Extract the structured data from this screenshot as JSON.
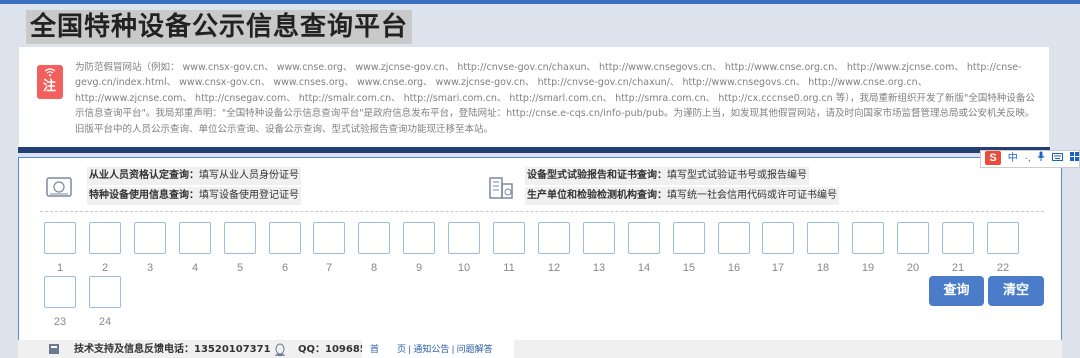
{
  "page": {
    "title": "全国特种设备公示信息查询平台"
  },
  "notice": {
    "icon_label": "注",
    "icon": "wifi-icon",
    "text": "为防范假冒网站（例如： www.cnsx-gov.cn、 www.cnse.org、 www.zjcnse-gov.cn、 http://cnvse-gov.cn/chaxun、 http://www.cnsegovs.cn、 http://www.cnse.org.cn、 http://www.zjcnse.com、 http://cnse-gevg.cn/index.html、 www.cnsx-gov.cn、 www.cnses.org、 www.cnse.org、 www.zjcnse-gov.cn、 http://cnvse-gov.cn/chaxun/、 http://www.cnsegovs.cn、 http://www.cnse.org.cn、 http://www.zjcnse.com、 http://cnsegav.com、 http://smalr.com.cn、 http://smari.com.cn、 http://smarl.com.cn、 http://smra.com.cn、 http://cx.cccnse0.org.cn 等），我局重新组织开发了新版\"全国特种设备公示信息查询平台\"。我局郑重声明：\"全国特种设备公示信息查询平台\"是政府信息发布平台，登陆网址：http://cnse.e-cqs.cn/info-pub/pub。为谨防上当，如发现其他假冒网站，请及时向国家市场监督管理总局或公安机关反映。旧版平台中的人员公示查询、单位公示查询、设备公示查询、型式试验报告查询功能现迁移至本站。"
  },
  "ime": {
    "logo": "S",
    "items": [
      "中",
      "·,",
      "mic-icon",
      "keyboard-icon",
      "grid-icon"
    ]
  },
  "query_left": {
    "icon": "id-card-icon",
    "items": [
      {
        "bold": "从业人员资格认定查询：",
        "hint": "填写从业人员身份证号"
      },
      {
        "bold": "特种设备使用信息查询：",
        "hint": "填写设备使用登记证号"
      }
    ]
  },
  "query_right": {
    "icon": "building-icon",
    "items": [
      {
        "bold": "设备型式试验报告和证书查询：",
        "hint": "填写型式试验证书号或报告编号"
      },
      {
        "bold": "生产单位和检验检测机构查询：",
        "hint": "填写统一社会信用代码或许可证书编号"
      }
    ]
  },
  "char_boxes": [
    "1",
    "2",
    "3",
    "4",
    "5",
    "6",
    "7",
    "8",
    "9",
    "10",
    "11",
    "12",
    "13",
    "14",
    "15",
    "16",
    "17",
    "18",
    "19",
    "20",
    "21",
    "22",
    "23",
    "24"
  ],
  "buttons": {
    "search": "查询",
    "clear": "清空"
  },
  "footer": {
    "phone_icon": "phone-icon",
    "support": "技术支持及信息反馈电话：13520107371",
    "qq_icon": "qq-icon",
    "qq": "QQ：1096856",
    "links": "首　　页 | 通知公告 | 问题解答"
  }
}
